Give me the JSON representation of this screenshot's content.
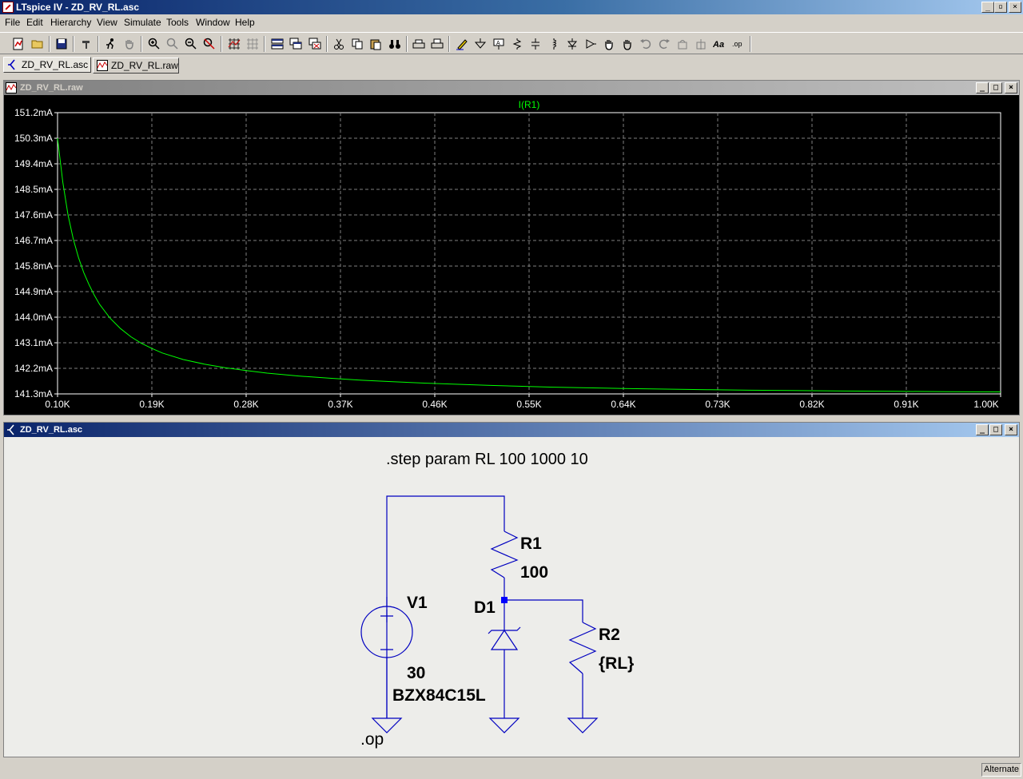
{
  "window": {
    "title": "LTspice IV - ZD_RV_RL.asc"
  },
  "menu": [
    "File",
    "Edit",
    "Hierarchy",
    "View",
    "Simulate",
    "Tools",
    "Window",
    "Help"
  ],
  "tabs": [
    {
      "label": "ZD_RV_RL.asc",
      "icon": "schematic-icon"
    },
    {
      "label": "ZD_RV_RL.raw",
      "icon": "waveform-icon"
    }
  ],
  "plot_window": {
    "title": "ZD_RV_RL.raw"
  },
  "schematic_window": {
    "title": "ZD_RV_RL.asc"
  },
  "chart_data": {
    "type": "line",
    "title": "I(R1)",
    "series": [
      {
        "name": "I(R1)",
        "color": "#00ff00",
        "x": [
          100,
          105,
          110,
          115,
          120,
          125,
          130,
          135,
          140,
          150,
          160,
          170,
          180,
          190,
          200,
          220,
          240,
          260,
          280,
          300,
          330,
          360,
          390,
          420,
          450,
          480,
          510,
          540,
          570,
          600,
          640,
          680,
          720,
          760,
          800,
          850,
          900,
          950,
          1000
        ],
        "y": [
          150.3,
          148.75,
          147.6,
          146.75,
          146.1,
          145.57,
          145.15,
          144.78,
          144.46,
          143.97,
          143.6,
          143.31,
          143.08,
          142.9,
          142.74,
          142.51,
          142.35,
          142.22,
          142.12,
          142.03,
          141.93,
          141.85,
          141.78,
          141.73,
          141.68,
          141.64,
          141.6,
          141.57,
          141.54,
          141.52,
          141.49,
          141.47,
          141.45,
          141.43,
          141.42,
          141.4,
          141.39,
          141.38,
          141.37
        ]
      }
    ],
    "x_ticks": [
      "0.10K",
      "0.19K",
      "0.28K",
      "0.37K",
      "0.46K",
      "0.55K",
      "0.64K",
      "0.73K",
      "0.82K",
      "0.91K",
      "1.00K"
    ],
    "y_ticks": [
      "151.2mA",
      "150.3mA",
      "149.4mA",
      "148.5mA",
      "147.6mA",
      "146.7mA",
      "145.8mA",
      "144.9mA",
      "144.0mA",
      "143.1mA",
      "142.2mA",
      "141.3mA"
    ],
    "xlim": [
      100,
      1000
    ],
    "ylim": [
      141.3,
      151.2
    ],
    "grid": true,
    "background": "#000000"
  },
  "schematic": {
    "directive_step": ".step param RL 100 1000 10",
    "directive_op": ".op",
    "V1": {
      "name": "V1",
      "value": "30"
    },
    "R1": {
      "name": "R1",
      "value": "100"
    },
    "R2": {
      "name": "R2",
      "value": "{RL}"
    },
    "D1": {
      "name": "D1",
      "value": "BZX84C15L"
    },
    "wire_color": "#0000c0"
  },
  "status": {
    "mode": "Alternate"
  }
}
